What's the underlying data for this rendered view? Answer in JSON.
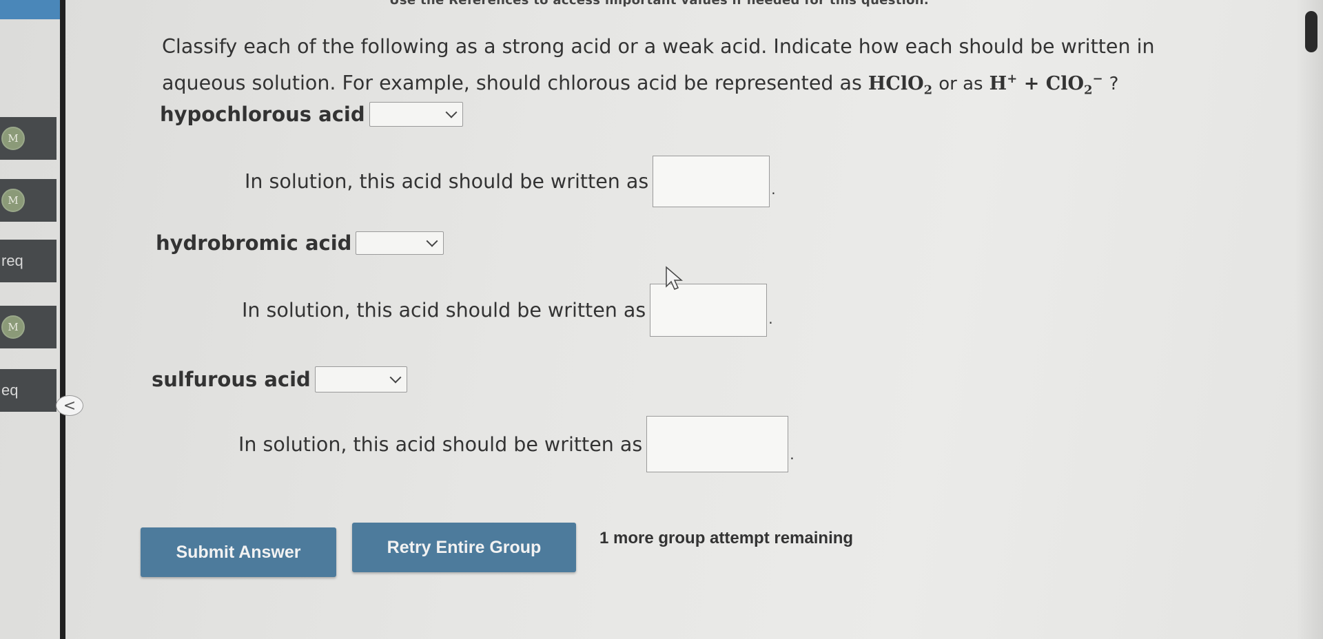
{
  "references_note": "Use the References to access important values if needed for this question.",
  "prompt": {
    "text1": "Classify each of the following as a strong acid or a weak acid. Indicate how each should be written in aqueous solution. For example, should chlorous acid be represented as",
    "formula_molecular": "HClO",
    "formula_molecular_sub": "2",
    "or_as": "or as",
    "formula_ion_h": "H",
    "formula_ion_h_charge": "+",
    "plus": "+",
    "formula_ion_anion": "ClO",
    "formula_ion_anion_sub": "2",
    "formula_ion_anion_charge": "−",
    "question_mark": "?"
  },
  "sidebar": {
    "items": [
      {
        "type": "badge",
        "label": "M"
      },
      {
        "type": "badge",
        "label": "M"
      },
      {
        "type": "text",
        "label": "req"
      },
      {
        "type": "badge",
        "label": "M"
      },
      {
        "type": "text",
        "label": "eq"
      }
    ],
    "collapse_label": "<"
  },
  "acids": [
    {
      "name": "hypochlorous acid",
      "selected": "",
      "written_prefix": "In solution, this acid should be written as",
      "period": "."
    },
    {
      "name": "hydrobromic acid",
      "selected": "",
      "written_prefix": "In solution, this acid should be written as",
      "period": "."
    },
    {
      "name": "sulfurous acid",
      "selected": "",
      "written_prefix": "In solution, this acid should be written as",
      "period": "."
    }
  ],
  "buttons": {
    "submit": "Submit Answer",
    "retry": "Retry Entire Group"
  },
  "attempts_text": "1 more group attempt remaining",
  "colors": {
    "button_bg": "#4d7b9c",
    "sidebar_bg": "#474a4c",
    "sidebar_top": "#4a87b9"
  }
}
